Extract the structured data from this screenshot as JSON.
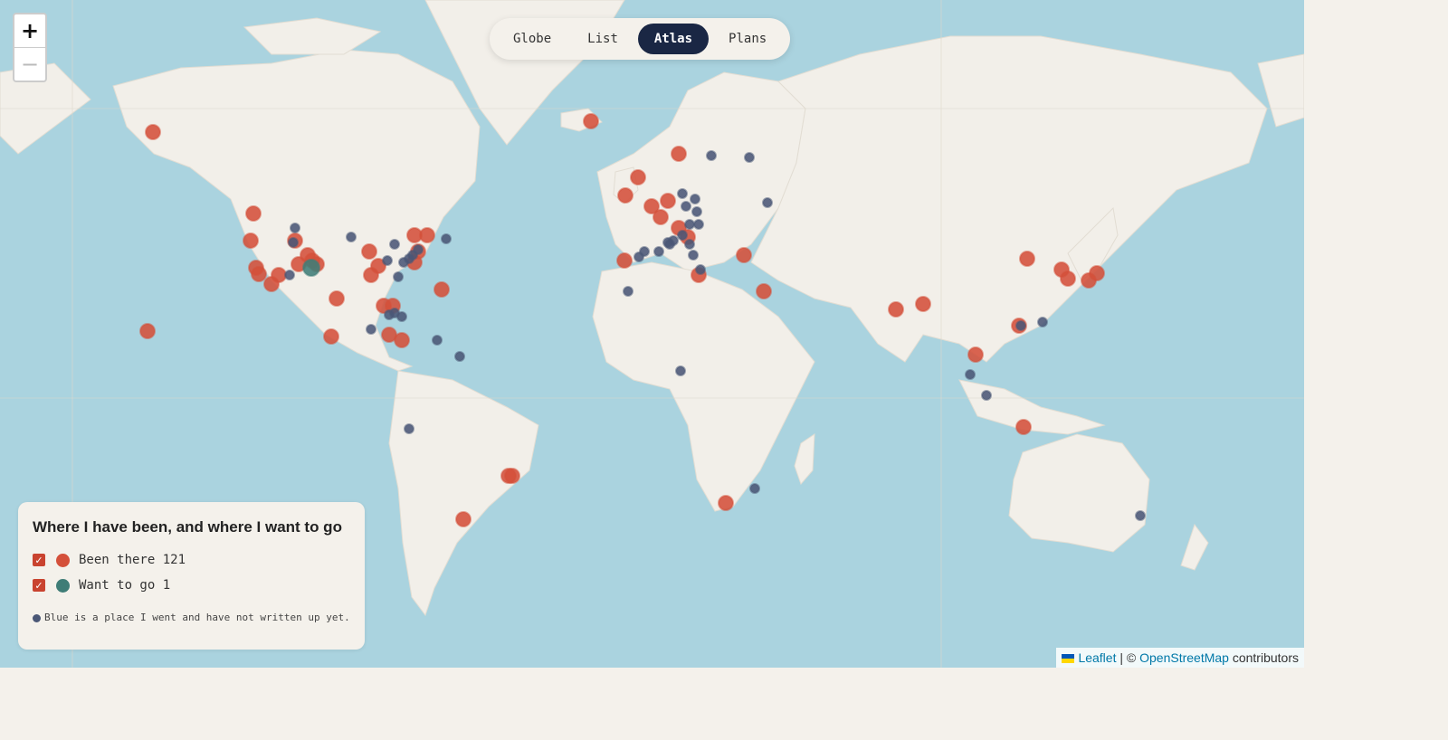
{
  "zoom": {
    "in_label": "+",
    "out_label": "−"
  },
  "modes": [
    {
      "label": "Globe",
      "active": false
    },
    {
      "label": "List",
      "active": false
    },
    {
      "label": "Atlas",
      "active": true
    },
    {
      "label": "Plans",
      "active": false
    }
  ],
  "legend": {
    "title": "Where I have been, and where I want to go",
    "been_label": "Been there 121",
    "want_label": "Want to go 1",
    "note": "Blue is a place I went and have not written up yet."
  },
  "attribution": {
    "leaflet": "Leaflet",
    "sep": " | © ",
    "osm": "OpenStreetMap",
    "suffix": " contributors"
  },
  "colors": {
    "water": "#aad3df",
    "land": "#f2efe9",
    "been": "#d4503a",
    "want": "#3f7d77",
    "unwritten": "#4a5776",
    "active_mode": "#1a2744",
    "checkbox": "#c9432f"
  },
  "marker_categories": [
    "been",
    "want",
    "unwritten"
  ]
}
